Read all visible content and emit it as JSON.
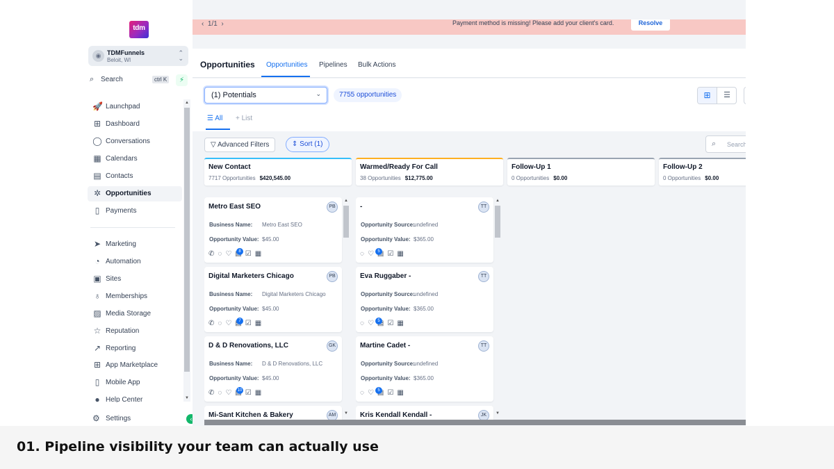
{
  "sidebar": {
    "logo_text": "tdm",
    "account": {
      "name": "TDMFunnels",
      "location": "Beloit, WI"
    },
    "search": {
      "label": "Search",
      "shortcut": "ctrl K"
    },
    "items_top": [
      {
        "label": "Launchpad",
        "icon": "rocket-icon"
      },
      {
        "label": "Dashboard",
        "icon": "grid-icon"
      },
      {
        "label": "Conversations",
        "icon": "chat-icon"
      },
      {
        "label": "Calendars",
        "icon": "calendar-icon"
      },
      {
        "label": "Contacts",
        "icon": "contacts-icon"
      },
      {
        "label": "Opportunities",
        "icon": "opportunities-icon",
        "active": true
      },
      {
        "label": "Payments",
        "icon": "payments-icon"
      }
    ],
    "items_bottom": [
      {
        "label": "Marketing",
        "icon": "send-icon"
      },
      {
        "label": "Automation",
        "icon": "automation-icon"
      },
      {
        "label": "Sites",
        "icon": "sites-icon"
      },
      {
        "label": "Memberships",
        "icon": "memberships-icon"
      },
      {
        "label": "Media Storage",
        "icon": "media-icon"
      },
      {
        "label": "Reputation",
        "icon": "star-icon"
      },
      {
        "label": "Reporting",
        "icon": "chart-icon"
      },
      {
        "label": "App Marketplace",
        "icon": "apps-icon"
      },
      {
        "label": "Mobile App",
        "icon": "mobile-icon"
      },
      {
        "label": "Help Center",
        "icon": "help-icon"
      }
    ],
    "settings_label": "Settings"
  },
  "banner": {
    "pagination": "1/1",
    "message": "Payment method is missing! Please add your client's card.",
    "action_label": "Resolve",
    "bg_color": "#f8c8c4"
  },
  "header": {
    "title": "Opportunities",
    "tabs": [
      "Opportunities",
      "Pipelines",
      "Bulk Actions"
    ]
  },
  "toolbar": {
    "pipeline_selected": "(1) Potentials",
    "count_label": "7755 opportunities",
    "view_all_label": "All",
    "view_list_label": "List"
  },
  "filters": {
    "advanced_label": "Advanced Filters",
    "sort_label": "Sort (1)",
    "search_placeholder": "Search"
  },
  "stages": [
    {
      "name": "New Contact",
      "count": "7717 Opportunities",
      "value": "$420,545.00",
      "color": "#36bffa"
    },
    {
      "name": "Warmed/Ready For Call",
      "count": "38 Opportunities",
      "value": "$12,775.00",
      "color": "#fdb022"
    },
    {
      "name": "Follow-Up 1",
      "count": "0 Opportunities",
      "value": "$0.00",
      "color": "#98a2b3"
    },
    {
      "name": "Follow-Up 2",
      "count": "0 Opportunities",
      "value": "$0.00",
      "color": "#98a2b3"
    }
  ],
  "columns": [
    {
      "cards": [
        {
          "name": "Metro East SEO",
          "initials": "PB",
          "f1_label": "Business Name:",
          "f1_value": "Metro East SEO",
          "f2_label": "Opportunity Value:",
          "f2_value": "$45.00",
          "tag_count": "8"
        },
        {
          "name": "Digital Marketers Chicago",
          "initials": "PB",
          "f1_label": "Business Name:",
          "f1_value": "Digital Marketers Chicago",
          "f2_label": "Opportunity Value:",
          "f2_value": "$45.00",
          "tag_count": "7"
        },
        {
          "name": "D & D Renovations, LLC",
          "initials": "GK",
          "f1_label": "Business Name:",
          "f1_value": "D & D Renovations, LLC",
          "f2_label": "Opportunity Value:",
          "f2_value": "$45.00",
          "tag_count": "10"
        },
        {
          "name": "Mi-Sant Kitchen & Bakery",
          "initials": "AM",
          "f1_label": "",
          "f1_value": "",
          "f2_label": "",
          "f2_value": "",
          "tag_count": ""
        }
      ]
    },
    {
      "cards": [
        {
          "name": "-",
          "initials": "TT",
          "f1_label": "Opportunity Source:",
          "f1_value": "undefined",
          "f2_label": "Opportunity Value:",
          "f2_value": "$365.00",
          "tag_count": "5"
        },
        {
          "name": "Eva Ruggaber -",
          "initials": "TT",
          "f1_label": "Opportunity Source:",
          "f1_value": "undefined",
          "f2_label": "Opportunity Value:",
          "f2_value": "$365.00",
          "tag_count": "5"
        },
        {
          "name": "Martine Cadet -",
          "initials": "TT",
          "f1_label": "Opportunity Source:",
          "f1_value": "undefined",
          "f2_label": "Opportunity Value:",
          "f2_value": "$365.00",
          "tag_count": "5"
        },
        {
          "name": "Kris Kendall Kendall -",
          "initials": "JK",
          "f1_label": "",
          "f1_value": "",
          "f2_label": "",
          "f2_value": "",
          "tag_count": ""
        }
      ]
    }
  ],
  "caption": "01. Pipeline visibility your team can actually use"
}
